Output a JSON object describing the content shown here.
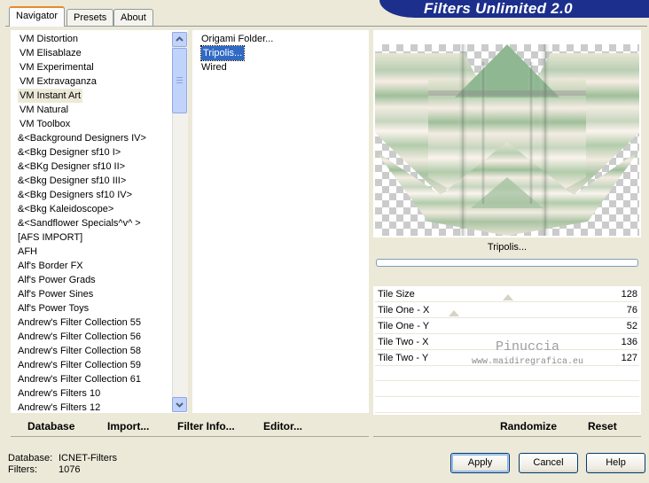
{
  "tabs": [
    {
      "label": "Navigator",
      "active": true
    },
    {
      "label": "Presets",
      "active": false
    },
    {
      "label": "About",
      "active": false
    }
  ],
  "app_title": "Filters Unlimited 2.0",
  "categories": [
    "VM Distortion",
    "VM Elisablaze",
    "VM Experimental",
    "VM Extravaganza",
    "VM Instant Art",
    "VM Natural",
    "VM Toolbox",
    "&<Background Designers IV>",
    "&<Bkg Designer sf10 I>",
    "&<BKg Designer sf10 II>",
    "&<Bkg Designer sf10 III>",
    "&<Bkg Designers sf10 IV>",
    "&<Bkg Kaleidoscope>",
    "&<Sandflower Specials^v^ >",
    "[AFS IMPORT]",
    "AFH",
    "Alf's Border FX",
    "Alf's Power Grads",
    "Alf's Power Sines",
    "Alf's Power Toys",
    "Andrew's Filter Collection 55",
    "Andrew's Filter Collection 56",
    "Andrew's Filter Collection 58",
    "Andrew's Filter Collection 59",
    "Andrew's Filter Collection 61",
    "Andrew's Filters 10",
    "Andrew's Filters 12"
  ],
  "selected_category": "VM Instant Art",
  "filters": [
    "Origami Folder...",
    "Tripolis...",
    "Wired"
  ],
  "selected_filter": "Tripolis...",
  "preview_filter_name": "Tripolis...",
  "params": [
    {
      "label": "Tile Size",
      "value": "128"
    },
    {
      "label": "Tile One - X",
      "value": "76"
    },
    {
      "label": "Tile One - Y",
      "value": "52"
    },
    {
      "label": "Tile Two - X",
      "value": "136"
    },
    {
      "label": "Tile Two - Y",
      "value": "127"
    }
  ],
  "watermark": {
    "line1": "Pinuccia",
    "line2": "www.maidiregrafica.eu"
  },
  "toolbar": {
    "database": "Database",
    "import": "Import...",
    "filter_info": "Filter Info...",
    "editor": "Editor...",
    "randomize": "Randomize",
    "reset": "Reset"
  },
  "info": {
    "database_label": "Database:",
    "database_value": "ICNET-Filters",
    "filters_label": "Filters:",
    "filters_value": "1076"
  },
  "buttons": {
    "apply": "Apply",
    "cancel": "Cancel",
    "help": "Help"
  },
  "colors": {
    "title_bar": "#1c2f8c",
    "selection": "#316ac5",
    "tab_highlight": "#e68b2c",
    "preview_green": "#8fb892"
  }
}
